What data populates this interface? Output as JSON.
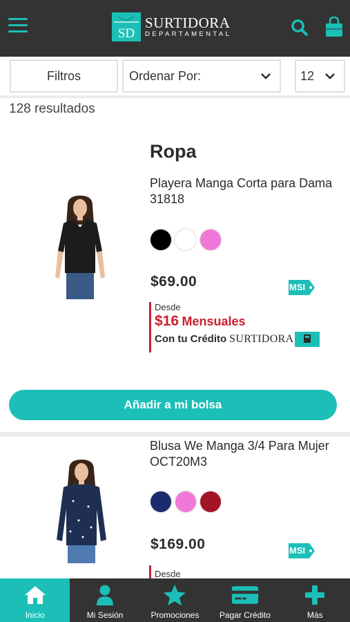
{
  "header": {
    "logo_title": "SURTIDORA",
    "logo_subtitle": "DEPARTAMENTAL",
    "logo_mark": "SD"
  },
  "filters": {
    "filtros_label": "Filtros",
    "orden_label": "Ordenar Por:",
    "count_value": "12"
  },
  "results_text": "128 resultados",
  "products": [
    {
      "category": "Ropa",
      "name": "Playera Manga Corta para Dama 31818",
      "colors": [
        "#000000",
        "#ffffff",
        "#f078d8"
      ],
      "price": "$69.00",
      "msi_label": "MSI",
      "credit": {
        "desde": "Desde",
        "amount": "$16",
        "period": "Mensuales",
        "con_tu_credito": "Con tu Crédito",
        "brand": "SURTIDORA"
      },
      "add_button": "Añadir a mi bolsa"
    },
    {
      "name": "Blusa We Manga 3/4 Para Mujer OCT20M3",
      "colors": [
        "#1c2a6e",
        "#f078d8",
        "#a31424"
      ],
      "price": "$169.00",
      "msi_label": "MSI",
      "credit": {
        "desde": "Desde"
      }
    }
  ],
  "bottom_nav": [
    {
      "label": "Inicio",
      "icon": "home-icon",
      "active": true
    },
    {
      "label": "Mi Sesión",
      "icon": "user-icon",
      "active": false
    },
    {
      "label": "Promociones",
      "icon": "star-icon",
      "active": false
    },
    {
      "label": "Pagar Crédito",
      "icon": "credit-card-icon",
      "active": false
    },
    {
      "label": "Más",
      "icon": "plus-icon",
      "active": false
    }
  ],
  "colors": {
    "accent": "#1cbfb7",
    "header_bg": "#333333",
    "credit_red": "#c8202f"
  }
}
